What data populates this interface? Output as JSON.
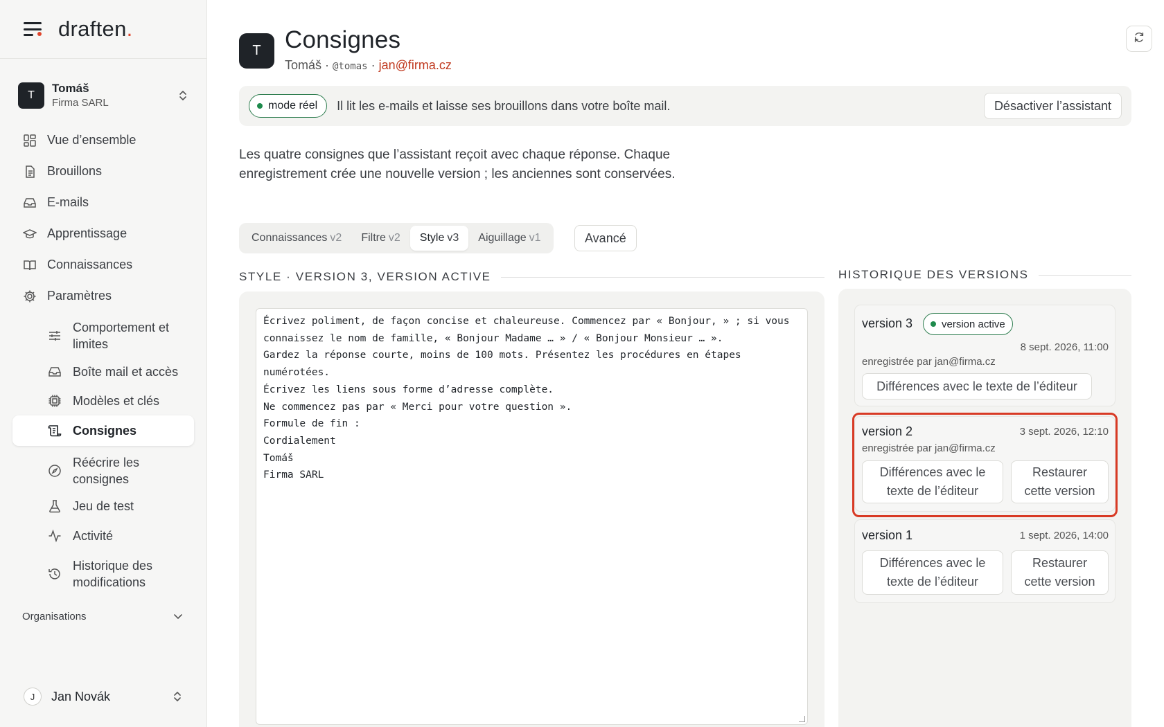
{
  "brand": {
    "name": "draften",
    "dot": "."
  },
  "account": {
    "initial": "T",
    "name": "Tomáš",
    "org": "Firma SARL"
  },
  "nav": {
    "overview": "Vue d’ensemble",
    "drafts": "Brouillons",
    "emails": "E-mails",
    "learning": "Apprentissage",
    "knowledge": "Connaissances",
    "settings": "Paramètres",
    "sub": {
      "behavior": "Comportement et limites",
      "mailbox": "Boîte mail et accès",
      "models": "Modèles et clés",
      "instructions": "Consignes",
      "rewrite": "Réécrire les consignes",
      "testset": "Jeu de test",
      "activity": "Activité",
      "history": "Historique des modifications"
    }
  },
  "organizations": "Organisations",
  "user": {
    "initial": "J",
    "name": "Jan Novák"
  },
  "page": {
    "initial": "T",
    "title": "Consignes",
    "meta_name": "Tomáš",
    "meta_sep": " · ",
    "handle": "@tomas",
    "email": "jan@firma.cz"
  },
  "banner": {
    "mode": "mode réel",
    "text": "Il lit les e-mails et laisse ses brouillons dans votre boîte mail.",
    "deactivate": "Désactiver l’assistant"
  },
  "intro": "Les quatre consignes que l’assistant reçoit avec chaque réponse. Chaque enregistrement crée une nouvelle version ; les anciennes sont conservées.",
  "tabs": [
    {
      "label": "Connaissances",
      "version": "v2"
    },
    {
      "label": "Filtre",
      "version": "v2"
    },
    {
      "label": "Style",
      "version": "v3"
    },
    {
      "label": "Aiguillage",
      "version": "v1"
    }
  ],
  "advanced": "Avancé",
  "editor": {
    "heading": "STYLE · VERSION 3, VERSION ACTIVE",
    "content": "Écrivez poliment, de façon concise et chaleureuse. Commencez par « Bonjour, » ; si vous connaissez le nom de famille, « Bonjour Madame … » / « Bonjour Monsieur … ».\nGardez la réponse courte, moins de 100 mots. Présentez les procédures en étapes numérotées.\nÉcrivez les liens sous forme d’adresse complète.\nNe commencez pas par « Merci pour votre question ».\nFormule de fin :\nCordialement\nTomáš\nFirma SARL"
  },
  "history": {
    "heading": "HISTORIQUE DES VERSIONS",
    "active_badge": "version active",
    "versions": [
      {
        "title": "version 3",
        "date": "8 sept. 2026, 11:00",
        "by": "enregistrée par jan@firma.cz",
        "diff": "Différences avec le texte de l’éditeur"
      },
      {
        "title": "version 2",
        "date": "3 sept. 2026, 12:10",
        "by": "enregistrée par jan@firma.cz",
        "diff": "Différences avec le texte de l’éditeur",
        "restore": "Restaurer cette version"
      },
      {
        "title": "version 1",
        "date": "1 sept. 2026, 14:00",
        "diff": "Différences avec le texte de l’éditeur",
        "restore": "Restaurer cette version"
      }
    ]
  },
  "colors": {
    "accent": "#e0462d",
    "active_green": "#1e8a4c",
    "highlight": "#d83a25",
    "link": "#c0391f"
  }
}
